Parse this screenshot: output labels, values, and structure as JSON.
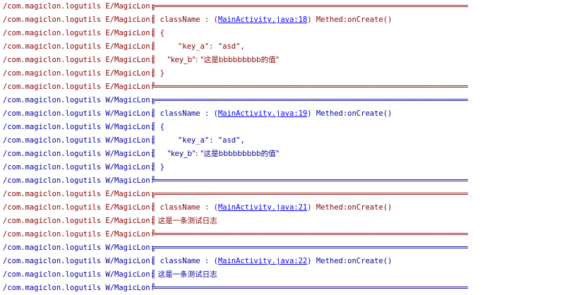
{
  "log": {
    "rows": [
      {
        "level": "E",
        "tag": "/com.magiclon.logutils E/MagicLon:",
        "text": "╔══════════════════════════════════════════════════════════════════════"
      },
      {
        "level": "E",
        "tag": "/com.magiclon.logutils E/MagicLon:",
        "pre": "║ className : (",
        "link": "MainActivity.java:18",
        "post": ") Methed:onCreate()"
      },
      {
        "level": "E",
        "tag": "/com.magiclon.logutils E/MagicLon:",
        "text": "║ {"
      },
      {
        "level": "E",
        "tag": "/com.magiclon.logutils E/MagicLon:",
        "text": "║     \"key_a\": \"asd\","
      },
      {
        "level": "E",
        "tag": "/com.magiclon.logutils E/MagicLon:",
        "text": "║     \"key_b\": \"这是bbbbbbbbb的值\""
      },
      {
        "level": "E",
        "tag": "/com.magiclon.logutils E/MagicLon:",
        "text": "║ }"
      },
      {
        "level": "E",
        "tag": "/com.magiclon.logutils E/MagicLon:",
        "text": "╚══════════════════════════════════════════════════════════════════════"
      },
      {
        "level": "W",
        "tag": "/com.magiclon.logutils W/MagicLon:",
        "text": "╔══════════════════════════════════════════════════════════════════════"
      },
      {
        "level": "W",
        "tag": "/com.magiclon.logutils W/MagicLon:",
        "pre": "║ className : (",
        "link": "MainActivity.java:19",
        "post": ") Methed:onCreate()"
      },
      {
        "level": "W",
        "tag": "/com.magiclon.logutils W/MagicLon:",
        "text": "║ {"
      },
      {
        "level": "W",
        "tag": "/com.magiclon.logutils W/MagicLon:",
        "text": "║     \"key_a\": \"asd\","
      },
      {
        "level": "W",
        "tag": "/com.magiclon.logutils W/MagicLon:",
        "text": "║     \"key_b\": \"这是bbbbbbbbb的值\""
      },
      {
        "level": "W",
        "tag": "/com.magiclon.logutils W/MagicLon:",
        "text": "║ }"
      },
      {
        "level": "W",
        "tag": "/com.magiclon.logutils W/MagicLon:",
        "text": "╚══════════════════════════════════════════════════════════════════════"
      },
      {
        "level": "E",
        "tag": "/com.magiclon.logutils E/MagicLon:",
        "text": "╔══════════════════════════════════════════════════════════════════════"
      },
      {
        "level": "E",
        "tag": "/com.magiclon.logutils E/MagicLon:",
        "pre": "║ className : (",
        "link": "MainActivity.java:21",
        "post": ") Methed:onCreate()"
      },
      {
        "level": "E",
        "tag": "/com.magiclon.logutils E/MagicLon:",
        "text": "║ 这是一条测试日志"
      },
      {
        "level": "E",
        "tag": "/com.magiclon.logutils E/MagicLon:",
        "text": "╚══════════════════════════════════════════════════════════════════════"
      },
      {
        "level": "W",
        "tag": "/com.magiclon.logutils W/MagicLon:",
        "text": "╔══════════════════════════════════════════════════════════════════════"
      },
      {
        "level": "W",
        "tag": "/com.magiclon.logutils W/MagicLon:",
        "pre": "║ className : (",
        "link": "MainActivity.java:22",
        "post": ") Methed:onCreate()"
      },
      {
        "level": "W",
        "tag": "/com.magiclon.logutils W/MagicLon:",
        "text": "║ 这是一条测试日志"
      },
      {
        "level": "W",
        "tag": "/com.magiclon.logutils W/MagicLon:",
        "text": "╚══════════════════════════════════════════════════════════════════════"
      }
    ]
  },
  "colors": {
    "error": "#8b0000",
    "warn": "#0000a0",
    "link": "#0000ff",
    "background": "#ffffff"
  }
}
